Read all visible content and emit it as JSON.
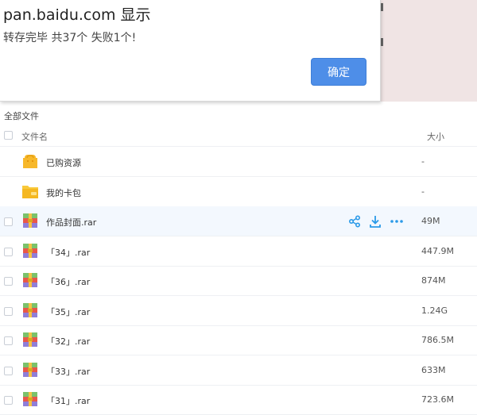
{
  "dialog": {
    "title": "pan.baidu.com 显示",
    "message": "转存完毕 共37个 失败1个!",
    "confirm_label": "确定"
  },
  "breadcrumb": "全部文件",
  "table": {
    "col_name": "文件名",
    "col_size": "大小"
  },
  "rows": [
    {
      "name": "已购资源",
      "size": "-",
      "icon": "purchased-folder-icon"
    },
    {
      "name": "我的卡包",
      "size": "-",
      "icon": "card-wallet-folder-icon"
    },
    {
      "name": "作品封面.rar",
      "size": "49M",
      "icon": "rar-archive-icon"
    },
    {
      "name": "「34」.rar",
      "size": "447.9M",
      "icon": "rar-archive-icon"
    },
    {
      "name": "「36」.rar",
      "size": "874M",
      "icon": "rar-archive-icon"
    },
    {
      "name": "「35」.rar",
      "size": "1.24G",
      "icon": "rar-archive-icon"
    },
    {
      "name": "「32」.rar",
      "size": "786.5M",
      "icon": "rar-archive-icon"
    },
    {
      "name": "「33」.rar",
      "size": "633M",
      "icon": "rar-archive-icon"
    },
    {
      "name": "「31」.rar",
      "size": "723.6M",
      "icon": "rar-archive-icon"
    }
  ],
  "colors": {
    "accent": "#4e8ee8",
    "action_icon": "#2b9ae8",
    "hover_row": "#f3f8fe"
  }
}
